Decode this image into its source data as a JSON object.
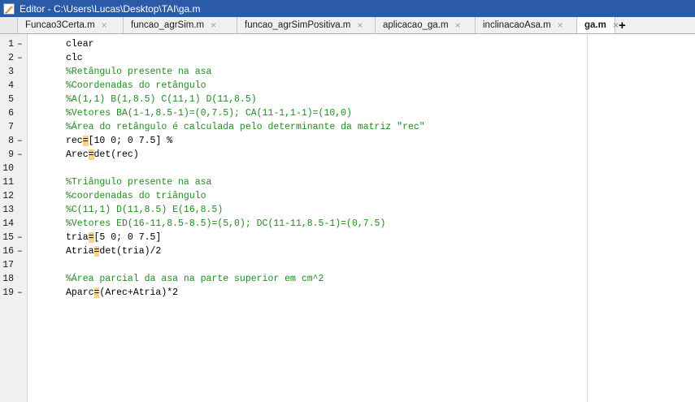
{
  "window": {
    "title": "Editor - C:\\Users\\Lucas\\Desktop\\TAI\\ga.m"
  },
  "tabs": [
    {
      "label": "Funcao3Certa.m",
      "active": false
    },
    {
      "label": "funcao_agrSim.m",
      "active": false
    },
    {
      "label": "funcao_agrSimPositiva.m",
      "active": false
    },
    {
      "label": "aplicacao_ga.m",
      "active": false
    },
    {
      "label": "inclinacaoAsa.m",
      "active": false
    },
    {
      "label": "ga.m",
      "active": true
    }
  ],
  "tab_close_glyph": "×",
  "tab_add_glyph": "+",
  "colors": {
    "titlebar": "#2b5aa6",
    "comment": "#228b22",
    "highlight": "#f5d38a"
  },
  "lines": [
    {
      "n": "1",
      "bp": "–",
      "code": "clear",
      "comment": false
    },
    {
      "n": "2",
      "bp": "–",
      "code": "clc",
      "comment": false
    },
    {
      "n": "3",
      "bp": "",
      "code": "%Retângulo presente na asa",
      "comment": true
    },
    {
      "n": "4",
      "bp": "",
      "code": "%Coordenadas do retângulo",
      "comment": true
    },
    {
      "n": "5",
      "bp": "",
      "code": "%A(1,1) B(1,8.5) C(11,1) D(11,8.5)",
      "comment": true
    },
    {
      "n": "6",
      "bp": "",
      "code": "%Vetores BA(1-1,8.5-1)=(0,7.5); CA(11-1,1-1)=(10,0)",
      "comment": true
    },
    {
      "n": "7",
      "bp": "",
      "code": "%Área do retângulo é calculada pelo determinante da matriz \"rec\"",
      "comment": true
    },
    {
      "n": "8",
      "bp": "–",
      "code_pre": "rec",
      "code_hl": "=",
      "code_post": "[10 0; 0 7.5] %",
      "comment": false
    },
    {
      "n": "9",
      "bp": "–",
      "code_pre": "Arec",
      "code_hl": "=",
      "code_post": "det(rec)",
      "comment": false
    },
    {
      "n": "10",
      "bp": "",
      "code": "",
      "comment": false
    },
    {
      "n": "11",
      "bp": "",
      "code": "%Triângulo presente na asa",
      "comment": true
    },
    {
      "n": "12",
      "bp": "",
      "code": "%coordenadas do triângulo",
      "comment": true
    },
    {
      "n": "13",
      "bp": "",
      "code": "%C(11,1) D(11,8.5) E(16,8.5)",
      "comment": true
    },
    {
      "n": "14",
      "bp": "",
      "code": "%Vetores ED(16-11,8.5-8.5)=(5,0); DC(11-11,8.5-1)=(0,7.5)",
      "comment": true
    },
    {
      "n": "15",
      "bp": "–",
      "code_pre": "tria",
      "code_hl": "=",
      "code_post": "[5 0; 0 7.5]",
      "comment": false
    },
    {
      "n": "16",
      "bp": "–",
      "code_pre": "Atria",
      "code_hl": "=",
      "code_post": "det(tria)/2",
      "comment": false
    },
    {
      "n": "17",
      "bp": "",
      "code": "",
      "comment": false
    },
    {
      "n": "18",
      "bp": "",
      "code": "%Área parcial da asa na parte superior em cm^2",
      "comment": true
    },
    {
      "n": "19",
      "bp": "–",
      "code_pre": "Aparc",
      "code_hl": "=",
      "code_post": "(Arec+Atria)*2",
      "comment": false
    }
  ]
}
